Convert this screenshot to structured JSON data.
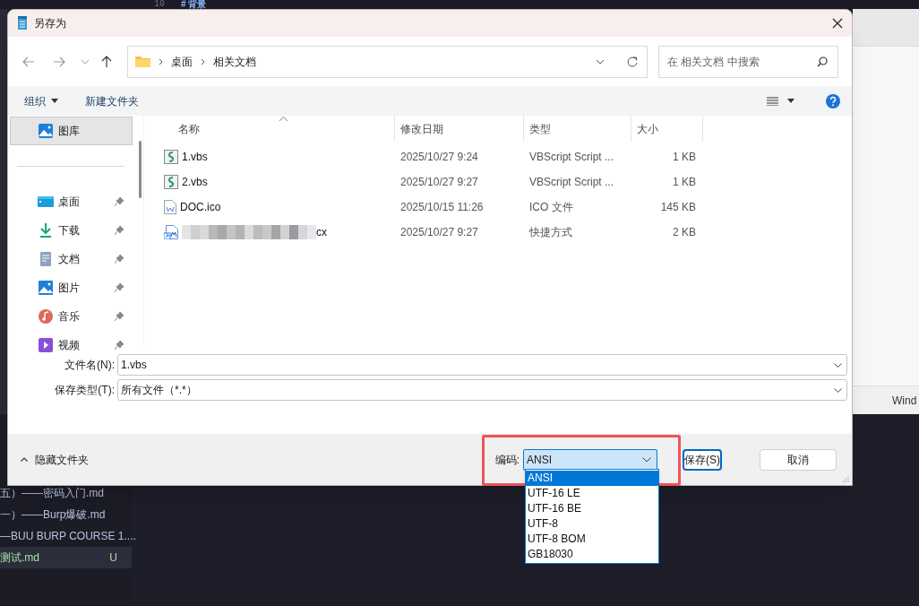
{
  "background": {
    "line_number": "10",
    "heading": "# 背景",
    "status_text": "Wind",
    "explorer_files": [
      {
        "name": "五）——密码入门.md",
        "selected": false
      },
      {
        "name": "一）——Burp爆破.md",
        "selected": false
      },
      {
        "name": "—BUU BURP COURSE 1....",
        "selected": false
      },
      {
        "name": "测试.md",
        "badge": "U",
        "selected": true
      }
    ]
  },
  "dialog": {
    "title": "另存为",
    "address": {
      "path": [
        "桌面",
        "相关文档"
      ]
    },
    "search": {
      "placeholder": "在 相关文档 中搜索"
    },
    "toolbar": {
      "organize": "组织",
      "new_folder": "新建文件夹"
    },
    "nav_pane": {
      "items": [
        {
          "label": "图库",
          "selected": true,
          "pinned": false
        },
        {
          "label": "桌面",
          "selected": false,
          "pinned": true
        },
        {
          "label": "下载",
          "selected": false,
          "pinned": true
        },
        {
          "label": "文档",
          "selected": false,
          "pinned": true
        },
        {
          "label": "图片",
          "selected": false,
          "pinned": true
        },
        {
          "label": "音乐",
          "selected": false,
          "pinned": true
        },
        {
          "label": "视频",
          "selected": false,
          "pinned": true
        }
      ]
    },
    "file_list": {
      "columns": [
        "名称",
        "修改日期",
        "类型",
        "大小"
      ],
      "rows": [
        {
          "kind": "script",
          "name": "1.vbs",
          "date": "2025/10/27 9:24",
          "type": "VBScript Script ...",
          "size": "1 KB"
        },
        {
          "kind": "script",
          "name": "2.vbs",
          "date": "2025/10/27 9:27",
          "type": "VBScript Script ...",
          "size": "1 KB"
        },
        {
          "kind": "image",
          "name": "DOC.ico",
          "date": "2025/10/15 11:26",
          "type": "ICO 文件",
          "size": "145 KB"
        },
        {
          "kind": "shortcut",
          "redacted": true,
          "name": "cx",
          "date": "2025/10/27 9:27",
          "type": "快捷方式",
          "size": "2 KB"
        }
      ]
    },
    "file_name": {
      "label": "文件名(N):",
      "value": "1.vbs"
    },
    "save_type": {
      "label": "保存类型(T):",
      "value": "所有文件（*.*）"
    },
    "hide_folders": "隐藏文件夹",
    "encoding": {
      "label": "编码:",
      "value": "ANSI",
      "expanded": true,
      "options": [
        {
          "label": "ANSI",
          "selected": true
        },
        {
          "label": "UTF-16 LE",
          "selected": false
        },
        {
          "label": "UTF-16 BE",
          "selected": false
        },
        {
          "label": "UTF-8",
          "selected": false
        },
        {
          "label": "UTF-8 BOM",
          "selected": false
        },
        {
          "label": "GB18030",
          "selected": false
        }
      ]
    },
    "buttons": [
      {
        "label": "保存(S)",
        "default": true
      },
      {
        "label": "取消",
        "default": false
      }
    ]
  }
}
